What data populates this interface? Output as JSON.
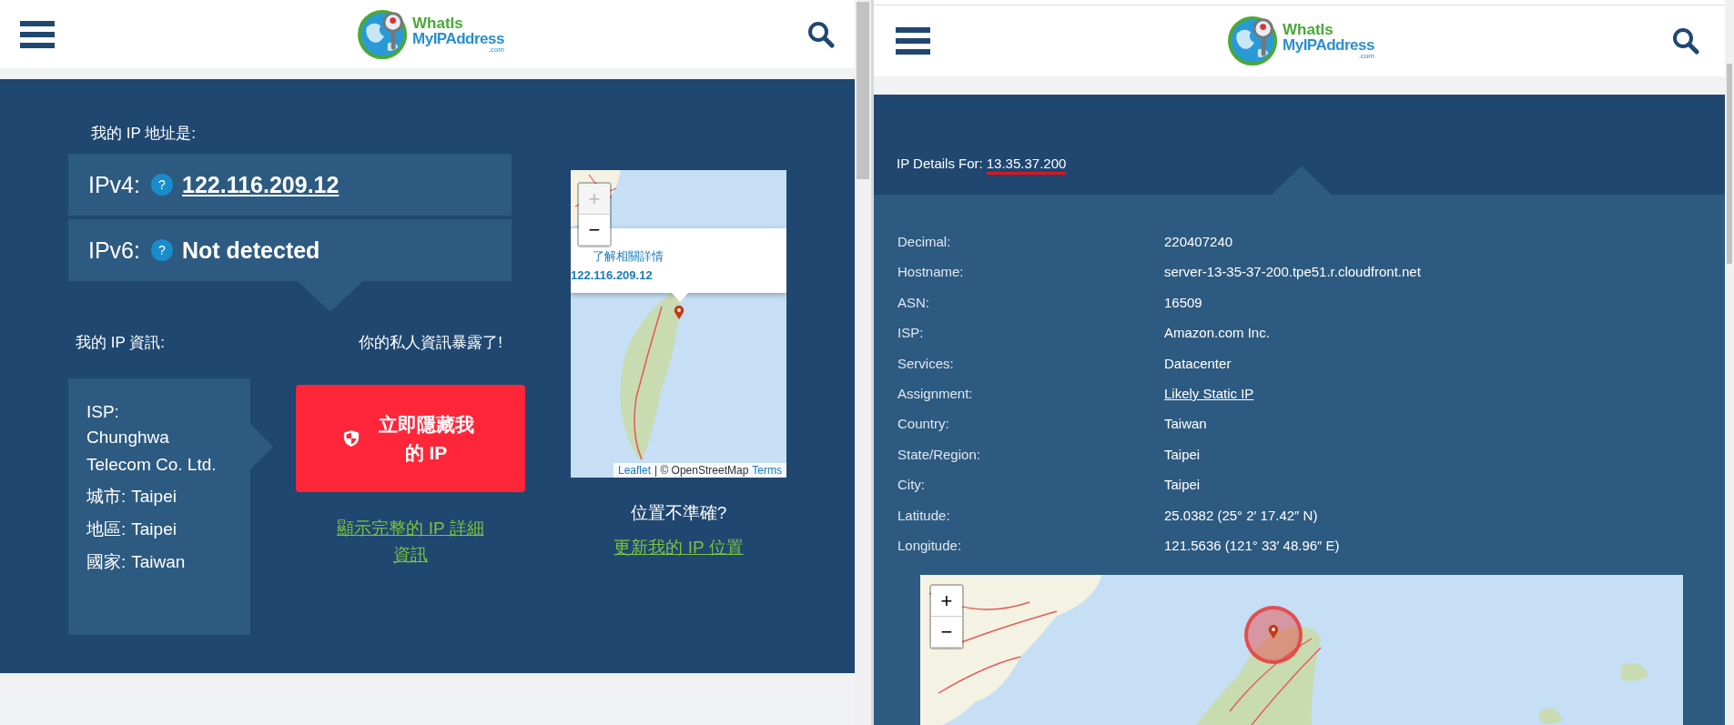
{
  "left_pane": {
    "header": {
      "logo": {
        "line1": "WhatIs",
        "line2": "MyIPAddress",
        "suffix": ".com"
      }
    },
    "ip_heading": "我的 IP 地址是:",
    "addresses": [
      {
        "label": "IPv4:",
        "help": "?",
        "value": "122.116.209.12",
        "kind": "link"
      },
      {
        "label": "IPv6:",
        "help": "?",
        "value": "Not detected",
        "kind": "text"
      }
    ],
    "info_heading": "我的 IP 資訊:",
    "info": {
      "isp_label": "ISP:",
      "isp": "Chunghwa Telecom Co. Ltd.",
      "rows": [
        {
          "label": "城市:",
          "value": "Taipei"
        },
        {
          "label": "地區:",
          "value": "Taipei"
        },
        {
          "label": "國家:",
          "value": "Taiwan"
        }
      ]
    },
    "exposed_heading": "你的私人資訊暴露了!",
    "hide_button": "立即隱藏我的 IP",
    "details_link": "顯示完整的 IP 詳細資訊",
    "map": {
      "zoom": [
        {
          "label": "+",
          "disabled": true
        },
        {
          "label": "−",
          "disabled": false
        }
      ],
      "popup": {
        "text": "了解相關詳情",
        "ip": "122.116.209.12"
      },
      "attribution": {
        "leaflet": "Leaflet",
        "separator": "| © OpenStreetMap",
        "terms": "Terms"
      }
    },
    "location_question": "位置不準確?",
    "update_link": "更新我的 IP 位置"
  },
  "right_pane": {
    "header": {
      "logo": {
        "line1": "WhatIs",
        "line2": "MyIPAddress",
        "suffix": ".com"
      }
    },
    "details_label": "IP Details For:",
    "details_ip": "13.35.37.200",
    "rows": [
      {
        "label": "Decimal:",
        "value": "220407240",
        "kind": "text"
      },
      {
        "label": "Hostname:",
        "value": "server-13-35-37-200.tpe51.r.cloudfront.net",
        "kind": "text"
      },
      {
        "label": "ASN:",
        "value": "16509",
        "kind": "text"
      },
      {
        "label": "ISP:",
        "value": "Amazon.com Inc.",
        "kind": "text"
      },
      {
        "label": "Services:",
        "value": "Datacenter",
        "kind": "text"
      },
      {
        "label": "Assignment:",
        "value": "Likely Static IP",
        "kind": "link"
      },
      {
        "label": "Country:",
        "value": "Taiwan",
        "kind": "text"
      },
      {
        "label": "State/Region:",
        "value": "Taipei",
        "kind": "text"
      },
      {
        "label": "City:",
        "value": "Taipei",
        "kind": "text"
      },
      {
        "label": "Latitude:",
        "value": "25.0382 (25° 2′ 17.42″ N)",
        "kind": "text"
      },
      {
        "label": "Longitude:",
        "value": "121.5636 (121° 33′ 48.96″ E)",
        "kind": "text"
      }
    ],
    "map": {
      "zoom": [
        {
          "label": "+",
          "disabled": false
        },
        {
          "label": "−",
          "disabled": false
        }
      ]
    }
  }
}
